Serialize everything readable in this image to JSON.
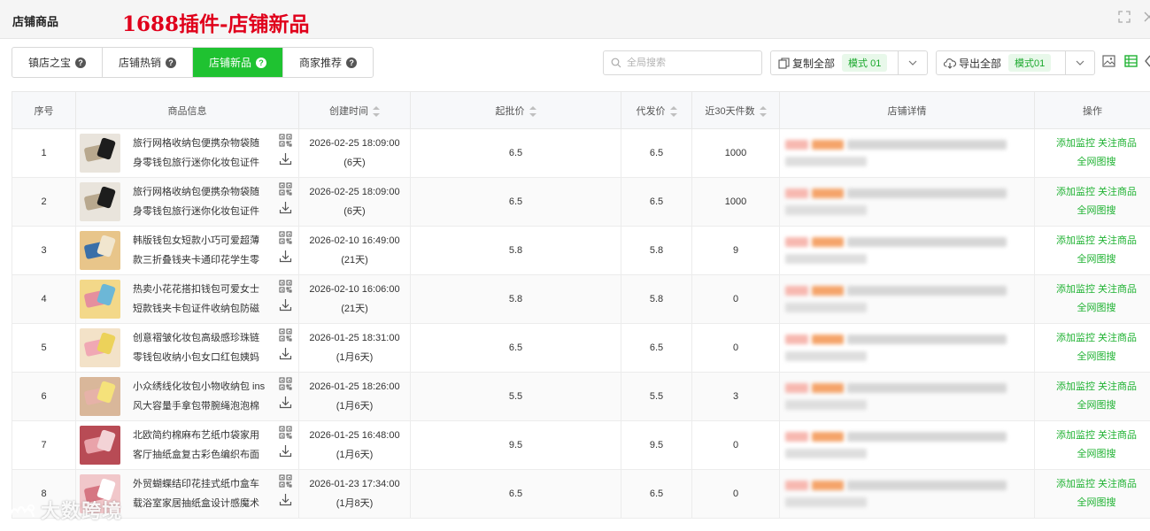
{
  "header": {
    "window_title": "店铺商品",
    "headline": "1688插件-店铺新品",
    "icons": [
      "expand-icon",
      "close-icon"
    ]
  },
  "tabs": [
    {
      "label": "镇店之宝",
      "active": false
    },
    {
      "label": "店铺热销",
      "active": false
    },
    {
      "label": "店铺新品",
      "active": true
    },
    {
      "label": "商家推荐",
      "active": false
    }
  ],
  "search": {
    "placeholder": "全局搜索",
    "value": ""
  },
  "copy_all": {
    "label": "复制全部",
    "mode": "模式 01"
  },
  "export_all": {
    "label": "导出全部",
    "mode": "模式01"
  },
  "colors": {
    "accent": "#1fc231",
    "link": "#1fb232",
    "headline": "#e0001b",
    "badge_bg": "#e8f8ea"
  },
  "table": {
    "columns": [
      "序号",
      "商品信息",
      "创建时间",
      "起批价",
      "代发价",
      "近30天件数",
      "店铺详情",
      "操作"
    ],
    "sortable": [
      "创建时间",
      "起批价",
      "代发价",
      "近30天件数"
    ],
    "rows": [
      {
        "idx": "1",
        "title": "旅行网格收纳包便携杂物袋随身零钱包旅行迷你化妆包证件包...",
        "created": "2026-02-25 18:09:00",
        "age": "(6天)",
        "wholesale": "6.5",
        "dropship": "6.5",
        "sales30": "1000"
      },
      {
        "idx": "2",
        "title": "旅行网格收纳包便携杂物袋随身零钱包旅行迷你化妆包证件包...",
        "created": "2026-02-25 18:09:00",
        "age": "(6天)",
        "wholesale": "6.5",
        "dropship": "6.5",
        "sales30": "1000"
      },
      {
        "idx": "3",
        "title": "韩版钱包女短款小巧可爱超薄款三折叠钱夹卡通印花学生零钱...",
        "created": "2026-02-10 16:49:00",
        "age": "(21天)",
        "wholesale": "5.8",
        "dropship": "5.8",
        "sales30": "9"
      },
      {
        "idx": "4",
        "title": "热卖小花花搭扣钱包可爱女士短款钱夹卡包证件收纳包防磁代...",
        "created": "2026-02-10 16:06:00",
        "age": "(21天)",
        "wholesale": "5.8",
        "dropship": "5.8",
        "sales30": "0"
      },
      {
        "idx": "5",
        "title": "创意褶皱化妆包高级感珍珠链零钱包收纳小包女口红包姨妈巾...",
        "created": "2026-01-25 18:31:00",
        "age": "(1月6天)",
        "wholesale": "6.5",
        "dropship": "6.5",
        "sales30": "0"
      },
      {
        "idx": "6",
        "title": "小众绣线化妆包小物收纳包 ins风大容量手拿包带腕绳泡泡棉零...",
        "created": "2026-01-25 18:26:00",
        "age": "(1月6天)",
        "wholesale": "5.5",
        "dropship": "5.5",
        "sales30": "3"
      },
      {
        "idx": "7",
        "title": "北欧简约棉麻布艺纸巾袋家用客厅抽纸盒复古彩色编织布面料...",
        "created": "2026-01-25 16:48:00",
        "age": "(1月6天)",
        "wholesale": "9.5",
        "dropship": "9.5",
        "sales30": "0"
      },
      {
        "idx": "8",
        "title": "外贸蝴蝶结印花挂式纸巾盒车载浴室家居抽纸盒设计感魔术贴...",
        "created": "2026-01-23 17:34:00",
        "age": "(1月8天)",
        "wholesale": "6.5",
        "dropship": "6.5",
        "sales30": "0"
      }
    ]
  },
  "ops": {
    "monitor": "添加监控",
    "follow": "关注商品",
    "image_search": "全网图搜"
  },
  "watermark": "大数跨境"
}
